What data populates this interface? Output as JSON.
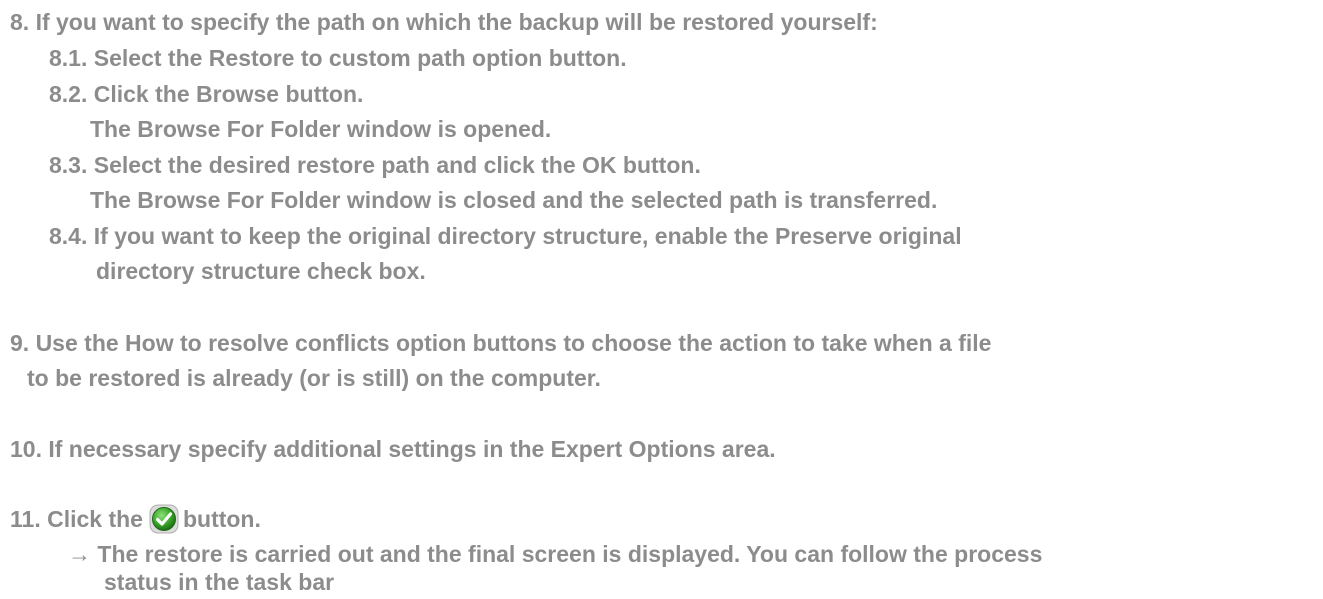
{
  "steps": {
    "s8": {
      "main": "8.  If you want to specify the path on which the backup will be restored yourself:",
      "s8_1": "8.1. Select the Restore to custom path option button.",
      "s8_2": "8.2. Click the Browse button.",
      "s8_2_result": "The Browse For Folder window is opened.",
      "s8_3": "8.3. Select the desired restore path and click the OK button.",
      "s8_3_result": "The Browse For Folder window is closed and the selected path is transferred.",
      "s8_4_a": "8.4. If you want to keep the original directory structure, enable the Preserve original",
      "s8_4_b": "directory structure check box."
    },
    "s9": {
      "a": "9. Use the How to resolve conflicts option buttons to choose the action to take when a file",
      "b": "to be restored is already (or is still) on the computer."
    },
    "s10": "10. If necessary specify additional settings in the Expert Options area.",
    "s11": {
      "before": "11. Click the",
      "icon": "green-checkmark-icon",
      "after": "button.",
      "result_a": "→ The restore is carried out and the final screen is displayed. You can follow the process",
      "result_b": "status in the task bar"
    }
  },
  "colors": {
    "text": "#8c8c8c",
    "icon_green": "#3aa82a"
  }
}
